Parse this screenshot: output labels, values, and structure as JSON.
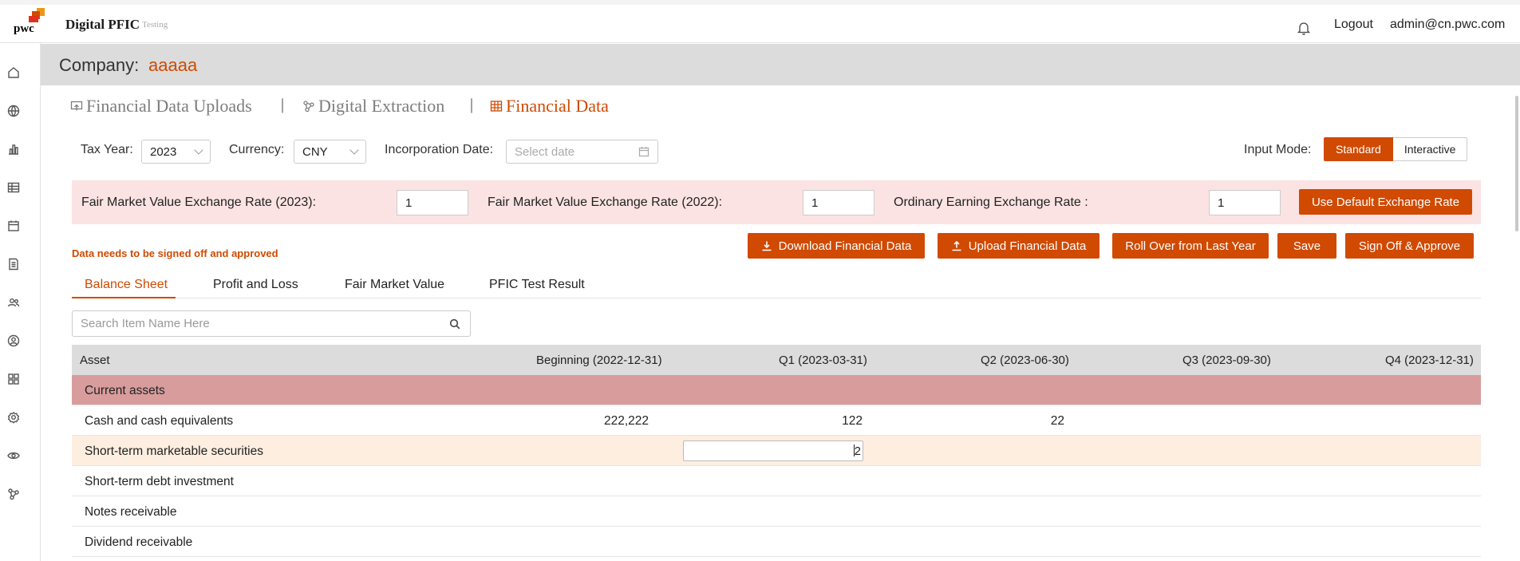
{
  "header": {
    "logo_text": "pwc",
    "app_title": "Digital PFIC",
    "environment": "Testing",
    "logout_label": "Logout",
    "user_email": "admin@cn.pwc.com"
  },
  "sidebar": {
    "icons": [
      "home-icon",
      "globe-icon",
      "chart-bar-icon",
      "table-icon",
      "calendar-icon",
      "document-icon",
      "users-icon",
      "user-circle-icon",
      "apps-grid-icon",
      "settings-icon",
      "eye-icon",
      "network-icon"
    ]
  },
  "company": {
    "label": "Company:",
    "name": "aaaaa"
  },
  "nav": {
    "uploads": "Financial Data Uploads",
    "extraction": "Digital Extraction",
    "financial": "Financial Data",
    "separator": "|"
  },
  "filters": {
    "tax_year_label": "Tax Year:",
    "tax_year_value": "2023",
    "currency_label": "Currency:",
    "currency_value": "CNY",
    "incorporation_label": "Incorporation Date:",
    "incorporation_placeholder": "Select date",
    "input_mode_label": "Input Mode:",
    "mode_standard": "Standard",
    "mode_interactive": "Interactive"
  },
  "rates": {
    "fmv_2023_label": "Fair Market Value Exchange Rate (2023):",
    "fmv_2023_value": "1",
    "fmv_2022_label": "Fair Market Value Exchange Rate (2022):",
    "fmv_2022_value": "1",
    "ordinary_label": "Ordinary Earning Exchange Rate :",
    "ordinary_value": "1",
    "default_button": "Use Default Exchange Rate"
  },
  "actions": {
    "warning": "Data needs to be signed off and approved",
    "download": "Download Financial Data",
    "upload": "Upload Financial Data",
    "rollover": "Roll Over from Last Year",
    "save": "Save",
    "signoff": "Sign Off & Approve"
  },
  "tabs": [
    "Balance Sheet",
    "Profit and Loss",
    "Fair Market Value",
    "PFIC Test Result"
  ],
  "search": {
    "placeholder": "Search Item Name Here"
  },
  "table": {
    "columns": [
      "Asset",
      "Beginning (2022-12-31)",
      "Q1 (2023-03-31)",
      "Q2 (2023-06-30)",
      "Q3 (2023-09-30)",
      "Q4 (2023-12-31)"
    ],
    "group": "Current assets",
    "rows": [
      {
        "label": "Cash and cash equivalents",
        "values": [
          "222,222",
          "122",
          "22",
          "",
          ""
        ]
      },
      {
        "label": "Short-term marketable securities",
        "values": [
          "",
          "2",
          "",
          "",
          ""
        ]
      },
      {
        "label": "Short-term debt investment",
        "values": [
          "",
          "",
          "",
          "",
          ""
        ]
      },
      {
        "label": "Notes receivable",
        "values": [
          "",
          "",
          "",
          "",
          ""
        ]
      },
      {
        "label": "Dividend receivable",
        "values": [
          "",
          "",
          "",
          "",
          ""
        ]
      }
    ]
  },
  "colors": {
    "accent": "#d04a02",
    "group_row": "#d89c9c",
    "rate_bar": "#fbe3e3",
    "highlight_row": "#fdeee0"
  }
}
